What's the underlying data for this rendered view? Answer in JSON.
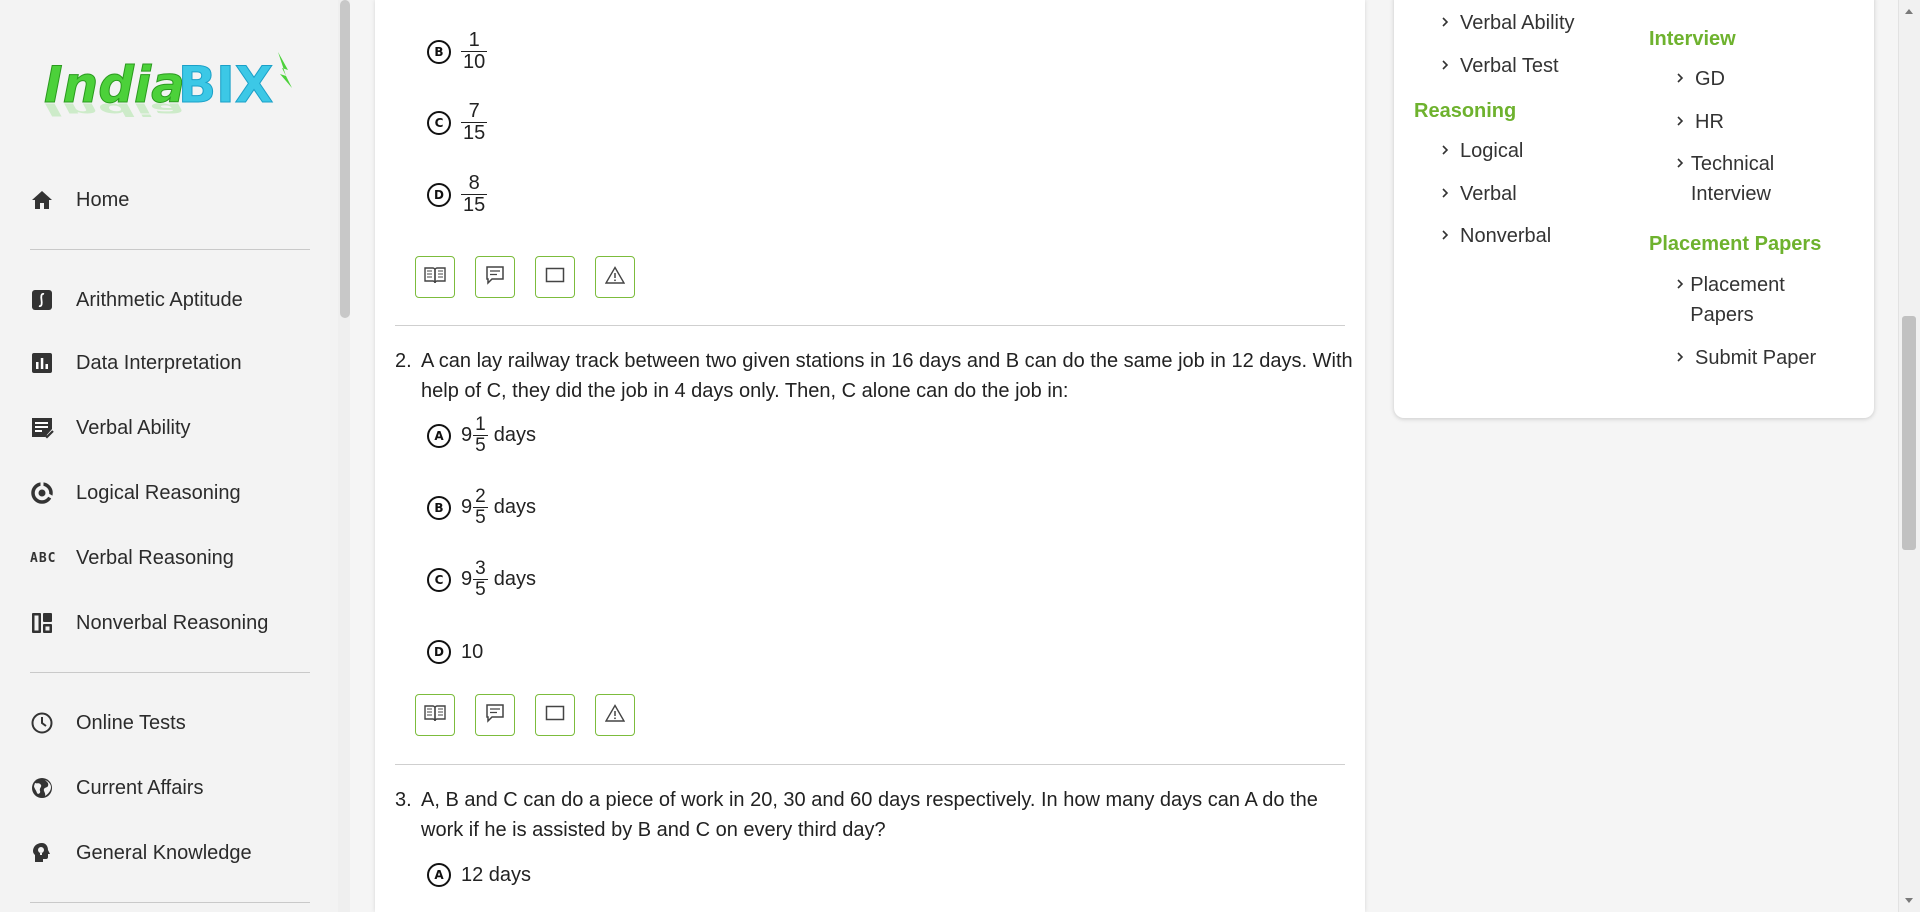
{
  "brand": {
    "logo_text": "IndiaBIX"
  },
  "sidebar": {
    "items": [
      {
        "label": "Home",
        "icon": "home-icon"
      },
      {
        "label": "Arithmetic Aptitude",
        "icon": "integral-icon"
      },
      {
        "label": "Data Interpretation",
        "icon": "bar-chart-icon"
      },
      {
        "label": "Verbal Ability",
        "icon": "checklist-icon"
      },
      {
        "label": "Logical Reasoning",
        "icon": "logic-icon"
      },
      {
        "label": "Verbal Reasoning",
        "icon": "abc-icon"
      },
      {
        "label": "Nonverbal Reasoning",
        "icon": "dashboard-icon"
      },
      {
        "label": "Online Tests",
        "icon": "clock-icon"
      },
      {
        "label": "Current Affairs",
        "icon": "globe-icon"
      },
      {
        "label": "General Knowledge",
        "icon": "bulb-head-icon"
      }
    ],
    "abc_glyph": "ABC"
  },
  "main": {
    "q1_options": [
      {
        "letter": "B",
        "num": "1",
        "den": "10"
      },
      {
        "letter": "C",
        "num": "7",
        "den": "15"
      },
      {
        "letter": "D",
        "num": "8",
        "den": "15"
      }
    ],
    "q2": {
      "number": "2.",
      "text": "A can lay railway track between two given stations in 16 days and B can do the same job in 12 days. With help of C, they did the job in 4 days only. Then, C alone can do the job in:",
      "options": [
        {
          "letter": "A",
          "whole": "9",
          "num": "1",
          "den": "5",
          "unit": "days"
        },
        {
          "letter": "B",
          "whole": "9",
          "num": "2",
          "den": "5",
          "unit": "days"
        },
        {
          "letter": "C",
          "whole": "9",
          "num": "3",
          "den": "5",
          "unit": "days"
        },
        {
          "letter": "D",
          "text": "10"
        }
      ]
    },
    "q3": {
      "number": "3.",
      "text": "A, B and C can do a piece of work in 20, 30 and 60 days respectively. In how many days can A do the work if he is assisted by B and C on every third day?",
      "options": [
        {
          "letter": "A",
          "text": "12 days"
        }
      ]
    },
    "actions": [
      "view-answer-icon",
      "discuss-icon",
      "workspace-icon",
      "report-icon"
    ]
  },
  "right_menu": {
    "col1": {
      "links_top": [
        "Verbal Ability",
        "Verbal Test"
      ],
      "reasoning_title": "Reasoning",
      "reasoning_links": [
        "Logical",
        "Verbal",
        "Nonverbal"
      ]
    },
    "col2": {
      "interview_title": "Interview",
      "interview_links": [
        "GD",
        "HR",
        "Technical Interview"
      ],
      "placement_title": "Placement Papers",
      "placement_links": [
        "Placement Papers",
        "Submit Paper"
      ]
    }
  },
  "colors": {
    "accent": "#6eb22e",
    "button_border": "#7cbc3c"
  }
}
